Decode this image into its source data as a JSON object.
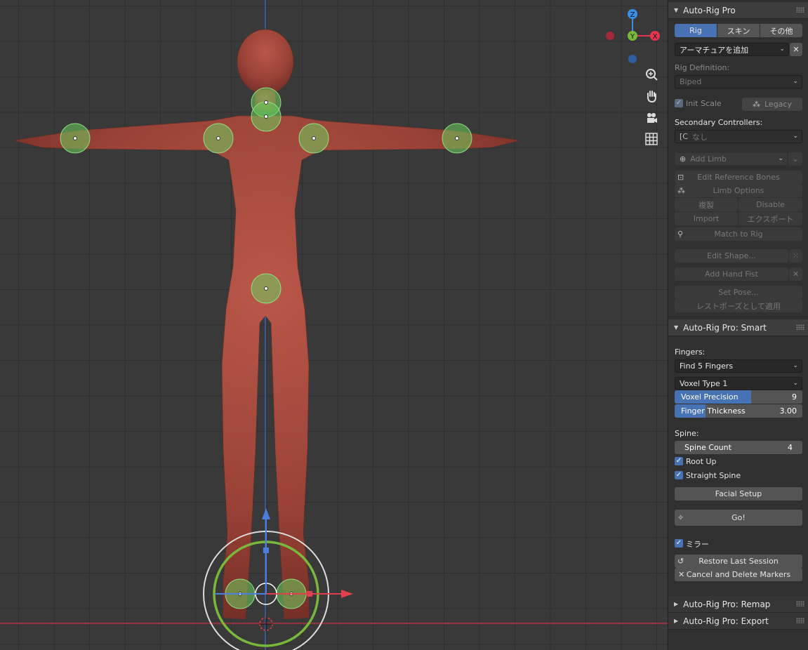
{
  "gizmo": {
    "z": "Z",
    "y": "Y",
    "x": "X"
  },
  "panel_main": {
    "title": "Auto-Rig Pro",
    "tabs": [
      "Rig",
      "スキン",
      "その他"
    ],
    "armature_dropdown": "アーマチュアを追加",
    "rig_definition_label": "Rig Definition:",
    "rig_definition_value": "Biped",
    "init_scale": "Init Scale",
    "legacy": "Legacy",
    "secondary_label": "Secondary Controllers:",
    "secondary_value": "なし",
    "add_limb": "Add Limb",
    "edit_reference_bones": "Edit Reference Bones",
    "limb_options": "Limb Options",
    "duplicate": "複製",
    "disable": "Disable",
    "import": "Import",
    "export": "エクスポート",
    "match_to_rig": "Match to Rig",
    "edit_shape": "Edit Shape...",
    "add_hand_fist": "Add Hand Fist",
    "set_pose": "Set Pose...",
    "apply_rest_pose": "レストポーズとして適用"
  },
  "panel_smart": {
    "title": "Auto-Rig Pro: Smart",
    "fingers_label": "Fingers:",
    "fingers_value": "Find 5 Fingers",
    "voxel_type": "Voxel Type 1",
    "voxel_precision_label": "Voxel Precision",
    "voxel_precision_value": "9",
    "voxel_precision_fraction": 0.6,
    "finger_thickness_label": "Finger Thickness",
    "finger_thickness_value": "3.00",
    "finger_thickness_fraction": 0.24,
    "spine_label": "Spine:",
    "spine_count_label": "Spine Count",
    "spine_count_value": "4",
    "root_up": "Root Up",
    "straight_spine": "Straight Spine",
    "facial_setup": "Facial Setup",
    "go": "Go!",
    "mirror": "ミラー",
    "restore_last_session": "Restore Last Session",
    "cancel_delete_markers": "Cancel and Delete Markers"
  },
  "panel_remap": {
    "title": "Auto-Rig Pro: Remap"
  },
  "panel_export": {
    "title": "Auto-Rig Pro: Export"
  },
  "icons": [
    "zoom-icon",
    "hand-pan-icon",
    "camera-icon",
    "grid-icon",
    "magic-wand-icon",
    "history-icon",
    "close-icon"
  ],
  "colors": {
    "accent": "#4772b3",
    "marker": "#6ecf5f",
    "body": "#a8493d"
  }
}
